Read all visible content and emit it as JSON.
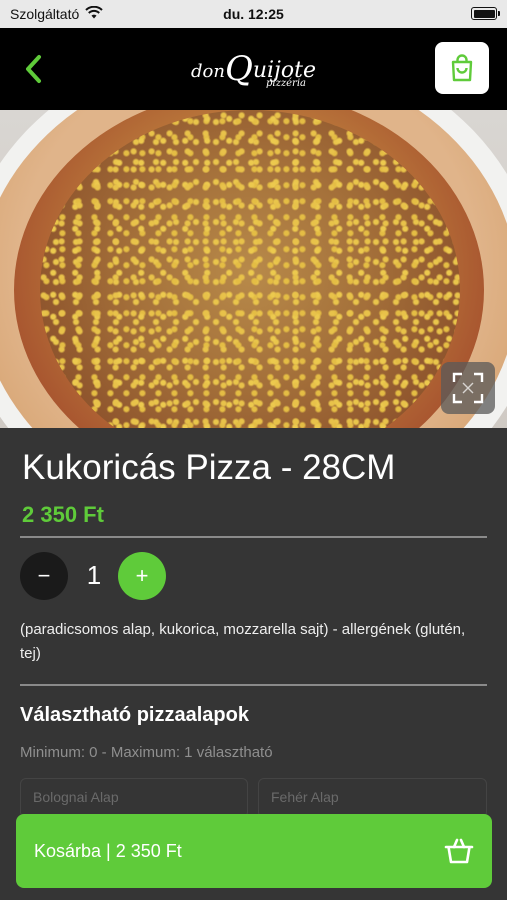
{
  "status_bar": {
    "carrier": "Szolgáltató",
    "time": "du. 12:25"
  },
  "header": {
    "logo": {
      "don": "don",
      "q": "Q",
      "rest": "uijote",
      "sub": "pizzéria"
    }
  },
  "product": {
    "title": "Kukoricás Pizza - 28CM",
    "price": "2 350 Ft",
    "quantity": "1",
    "minus_label": "−",
    "plus_label": "+",
    "description": "(paradicsomos alap, kukorica, mozzarella sajt) - allergének (glutén, tej)"
  },
  "options": {
    "title": "Választható pizzaalapok",
    "subtitle": "Minimum: 0 - Maximum: 1 választható",
    "items": [
      "Bolognai Alap",
      "Fehér Alap"
    ]
  },
  "cta": {
    "label": "Kosárba | 2 350 Ft"
  },
  "colors": {
    "accent": "#5fcb3a",
    "background": "#353535",
    "header": "#000000"
  }
}
